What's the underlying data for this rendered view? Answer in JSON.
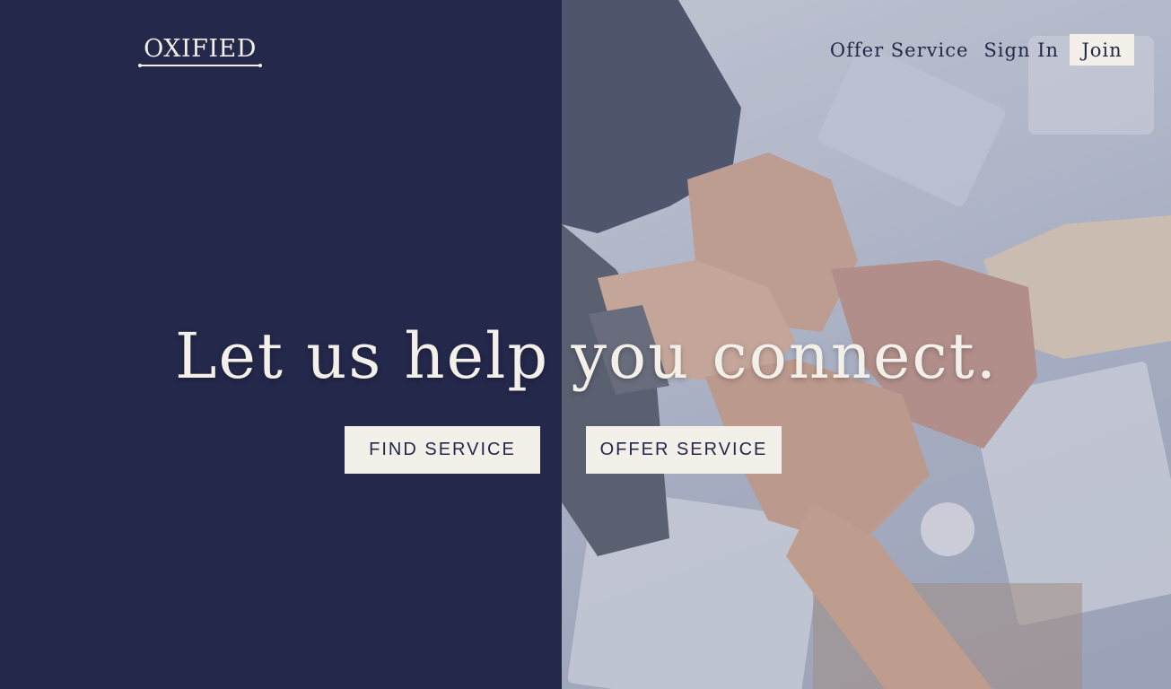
{
  "brand": {
    "logo_text": "OXIFIED"
  },
  "nav": {
    "offer_service": "Offer Service",
    "sign_in": "Sign In",
    "join": "Join"
  },
  "hero": {
    "headline": "Let us help you connect.",
    "find_service_button": "FIND SERVICE",
    "offer_service_button": "OFFER SERVICE"
  },
  "colors": {
    "navy": "#24284a",
    "cream": "#f3efe9"
  }
}
